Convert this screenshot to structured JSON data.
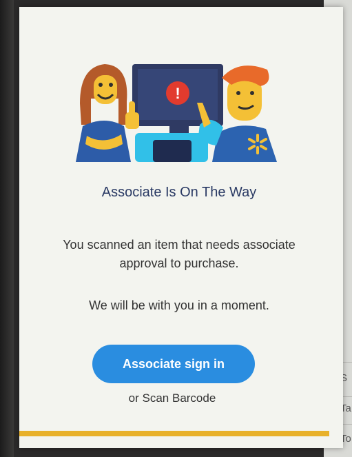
{
  "modal": {
    "title": "Associate Is On The Way",
    "message_1": "You scanned an item that needs associate approval to purchase.",
    "message_2": "We will be with you in a moment.",
    "sign_in_label": "Associate sign in",
    "scan_label": "or Scan Barcode",
    "alert_glyph": "!"
  },
  "background": {
    "partial_chars": [
      "S",
      "Ta",
      "To"
    ]
  },
  "colors": {
    "primary_button": "#2a8de0",
    "title_text": "#2a3a64",
    "accent_bar": "#e8b12a",
    "alert_red": "#e23b2e"
  },
  "icons": [
    "alert-icon",
    "spark-icon",
    "thumbs-up-icon"
  ]
}
